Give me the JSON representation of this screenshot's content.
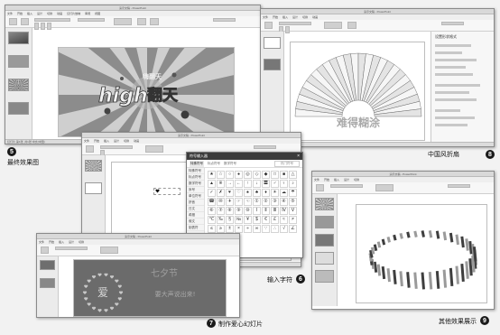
{
  "captions": {
    "c5": {
      "num": "5",
      "label": "最终效果图"
    },
    "c6": {
      "num": "6",
      "label": "输入字符"
    },
    "c7": {
      "num": "7",
      "label": "制作爱心幻灯片"
    },
    "c8": {
      "num": "8",
      "label": "中国风折扇"
    },
    "c9": {
      "num": "9",
      "label": "其他效果展示"
    }
  },
  "win5": {
    "slide_text_big": "high",
    "slide_text_cn": "翻天",
    "slide_text_small": "嗨翻天"
  },
  "win8": {
    "slide_text": "难得糊涂",
    "panel_title": "设置形状格式"
  },
  "win6": {
    "dialog_title": "符号输入器",
    "dialog_tabs": [
      "特殊符号",
      "标点符号",
      "数学符号"
    ],
    "dialog_search": "热门符号",
    "side_items": [
      "特殊符号",
      "标点符号",
      "数学符号",
      "序号",
      "单位符号",
      "拼音",
      "日文",
      "希腊",
      "俄文",
      "制表符"
    ],
    "symbols": [
      "★",
      "☆",
      "○",
      "●",
      "◎",
      "◇",
      "◆",
      "□",
      "■",
      "△",
      "▲",
      "※",
      "→",
      "←",
      "↑",
      "↓",
      "〓",
      "♂",
      "♀",
      "♪",
      "✓",
      "✗",
      "♥",
      "♡",
      "♠",
      "♣",
      "♦",
      "☀",
      "☁",
      "☂",
      "☎",
      "✉",
      "✈",
      "☞",
      "☜",
      "①",
      "②",
      "③",
      "④",
      "⑤",
      "⑥",
      "⑦",
      "⑧",
      "⑨",
      "⑩",
      "Ⅰ",
      "Ⅱ",
      "Ⅲ",
      "Ⅳ",
      "Ⅴ",
      "℃",
      "‰",
      "§",
      "№",
      "¥",
      "$",
      "€",
      "£",
      "≈",
      "≠",
      "≤",
      "≥",
      "±",
      "×",
      "÷",
      "∞",
      "∵",
      "∴",
      "√",
      "∠"
    ]
  },
  "win7": {
    "slide_title": "七夕节",
    "slide_heart_char": "爱",
    "slide_subtitle": "要大声说出来!"
  },
  "ui": {
    "app_title": "演示文稿 - PowerPoint",
    "tabs": [
      "文件",
      "开始",
      "插入",
      "设计",
      "切换",
      "动画",
      "幻灯片放映",
      "审阅",
      "视图"
    ],
    "status": "幻灯片 第1张, 共1张  中文(中国)"
  },
  "colors": {
    "badge": "#1a1a1a",
    "slide_bg_dark": "#6b6b6b",
    "fan_stroke": "#555555"
  }
}
